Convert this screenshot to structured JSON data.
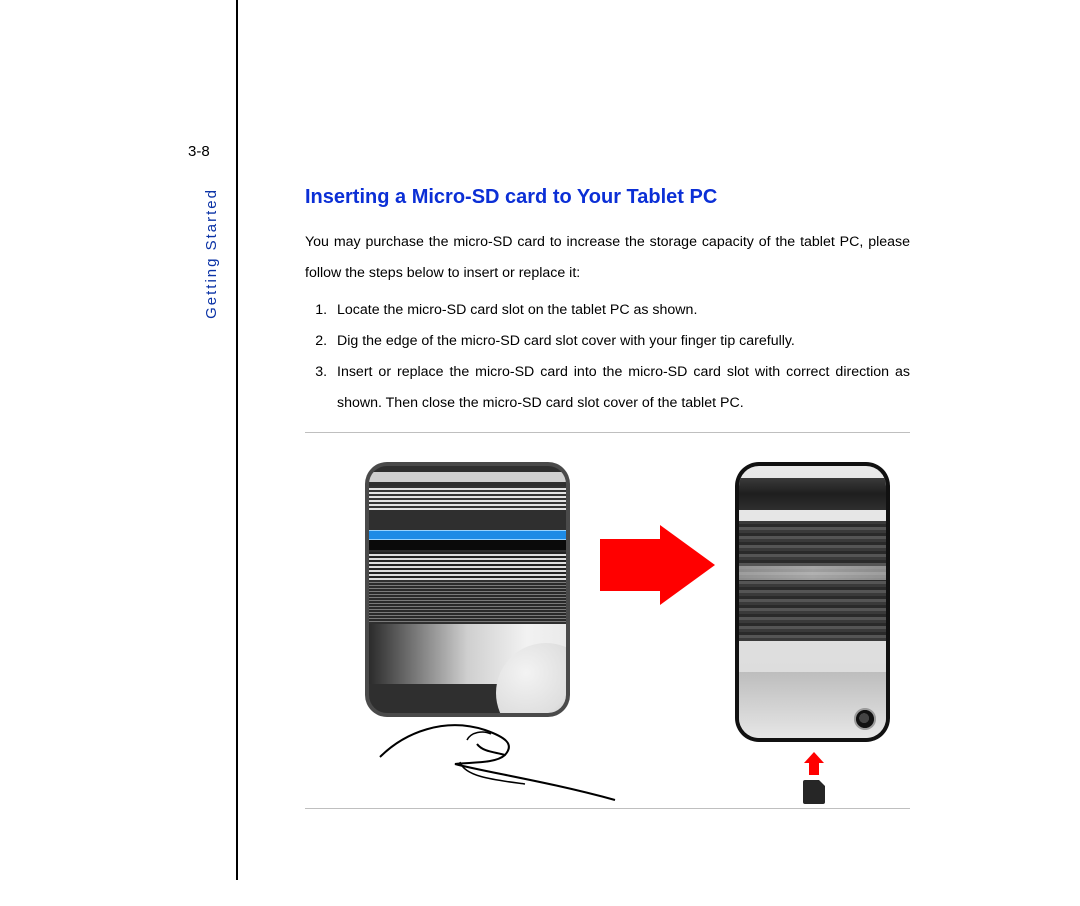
{
  "page_number": "3-8",
  "side_label": "Getting Started",
  "heading": "Inserting a Micro-SD card to Your Tablet PC",
  "intro": "You may purchase the micro-SD card to increase the storage capacity of the tablet PC, please follow the steps below to insert or replace it:",
  "steps": {
    "s1": "Locate the micro-SD card slot on the tablet PC as shown.",
    "s2": "Dig the edge of the micro-SD card slot cover with your finger tip carefully.",
    "s3": "Insert or replace the micro-SD card into the micro-SD card slot with correct direction as shown. Then close the micro-SD card slot cover of the tablet PC."
  },
  "colors": {
    "heading": "#0b2fd6",
    "side_label": "#0b33a6",
    "accent_red": "#ff0000",
    "accent_blue_stripe": "#1d8be6"
  }
}
